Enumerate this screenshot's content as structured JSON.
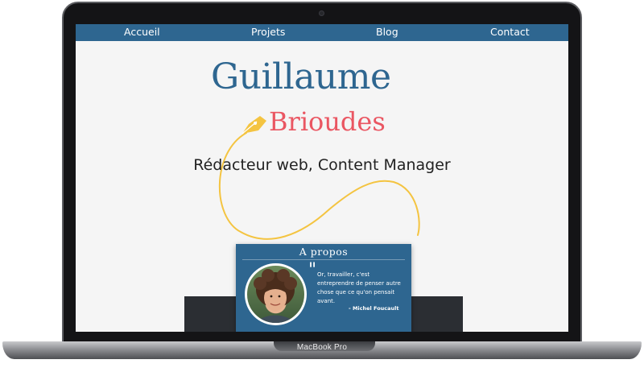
{
  "nav": {
    "items": [
      {
        "label": "Accueil"
      },
      {
        "label": "Projets"
      },
      {
        "label": "Blog"
      },
      {
        "label": "Contact"
      }
    ]
  },
  "hero": {
    "first_name": "Guillaume",
    "last_name": "Brioudes",
    "subtitle": "Rédacteur web, Content Manager"
  },
  "about": {
    "title": "A propos",
    "quote": "Or, travailler, c'est entreprendre de penser autre chose que ce qu'on pensait avant.",
    "author": "- Michel Foucault"
  },
  "device": {
    "label": "MacBook Pro"
  },
  "colors": {
    "brand_blue": "#2e6690",
    "accent_red": "#ea5662",
    "accent_yellow": "#f4c441"
  },
  "icons": {
    "pen": "fountain-pen-nib-icon",
    "avatar": "profile-photo"
  }
}
